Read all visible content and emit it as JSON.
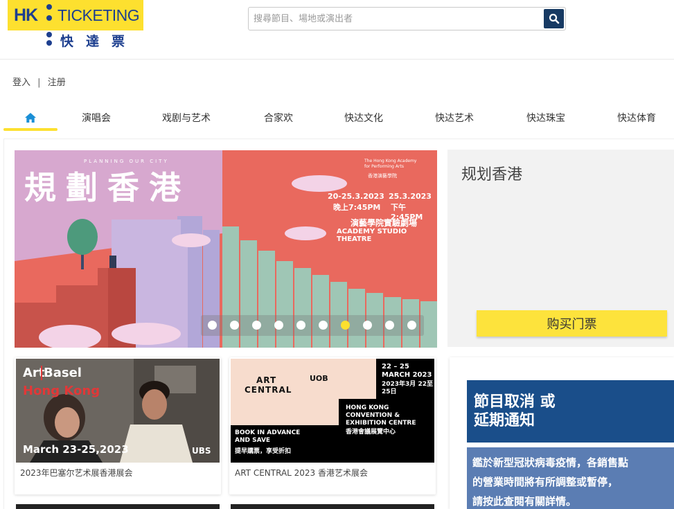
{
  "header": {
    "logo_hk": "HK",
    "logo_ticketing": "TICKETING",
    "logo_cn": "快達票",
    "search_placeholder": "搜尋節目、場地或演出者"
  },
  "auth": {
    "login": "登入",
    "separator": "|",
    "register": "注册"
  },
  "nav": {
    "items": [
      {
        "label": "演唱会"
      },
      {
        "label": "戏剧与艺术"
      },
      {
        "label": "合家欢"
      },
      {
        "label": "快达文化"
      },
      {
        "label": "快达艺术"
      },
      {
        "label": "快达珠宝"
      },
      {
        "label": "快达体育"
      }
    ],
    "active_index": 0
  },
  "banner": {
    "title_art": "規劃香港",
    "en_subtitle": "PLANNING OUR CITY",
    "org": "The Hong Kong Academy for Performing Arts",
    "org_cn": "香港演藝學院",
    "date1": "20-25.3.2023",
    "time1": "晚上7:45PM",
    "date2": "25.3.2023",
    "time2": "下午2:45PM",
    "venue_cn": "演藝學院實驗劇場",
    "venue_en": "ACADEMY STUDIO THEATRE",
    "dot_count": 10,
    "active_dot": 6
  },
  "featured": {
    "title": "规划香港",
    "buy_label": "购买门票"
  },
  "cards": [
    {
      "caption": "2023年巴塞尔艺术展香港展会",
      "brand1": "Art",
      "brand2": "Basel",
      "city": "Hong Kong",
      "dates": "March 23-25,2023",
      "sponsor": "UBS"
    },
    {
      "caption": "ART CENTRAL 2023 香港艺术展会",
      "logo1": "ART",
      "logo2": "CENTRAL",
      "sponsor": "UOB",
      "dates_en": "22 – 25 MARCH 2023",
      "dates_cn": "2023年3月 22至25日",
      "venue_en": "HONG KONG CONVENTION & EXHIBITION CENTRE",
      "venue_cn": "香港會議展覽中心",
      "promo_en": "BOOK IN ADVANCE AND SAVE",
      "promo_cn": "提早購票，享受折扣"
    }
  ],
  "notice": {
    "title_line1": "節目取消 或",
    "title_line2": "延期通知",
    "body_line1": "鑑於新型冠狀病毒疫情，各銷售點",
    "body_line2": "的營業時間將有所調整或暫停，",
    "body_line3": "請按此查閱有關詳情。"
  },
  "colors": {
    "brand_yellow": "#fde02f",
    "brand_navy": "#1d3f8f",
    "search_btn": "#173a63"
  }
}
